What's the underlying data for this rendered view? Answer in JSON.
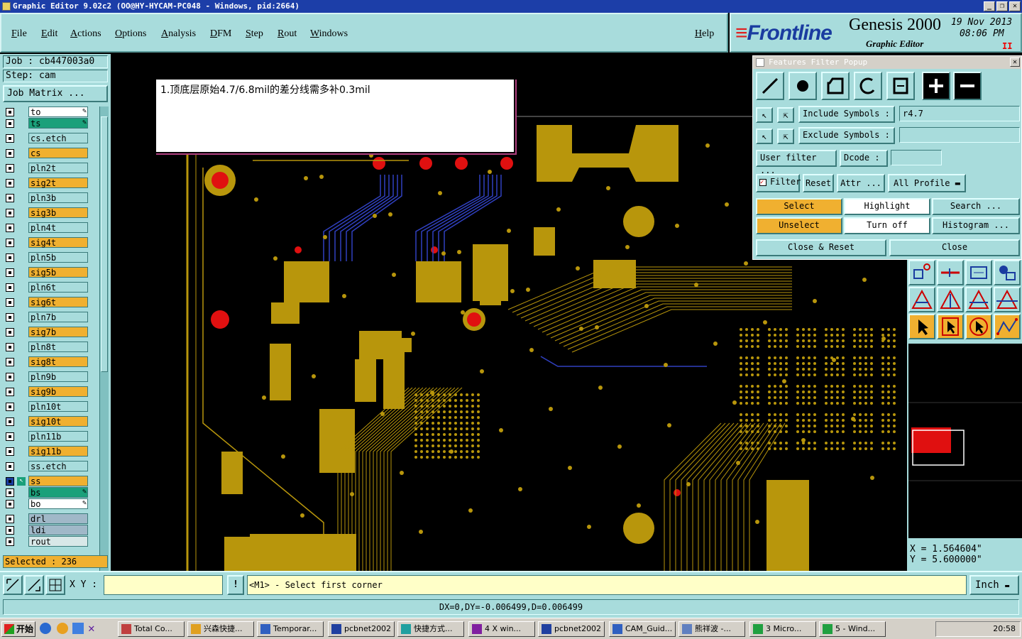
{
  "window": {
    "title": "Graphic Editor 9.02c2  (OO@HY-HYCAM-PC048 - Windows, pid:2664)"
  },
  "menu": [
    "File",
    "Edit",
    "Actions",
    "Options",
    "Analysis",
    "DFM",
    "Step",
    "Rout",
    "Windows"
  ],
  "help_label": "Help",
  "brand": {
    "logo": "Frontline",
    "product": "Genesis 2000",
    "subtitle": "Graphic Editor",
    "date": "19 Nov 2013",
    "time": "08:06 PM",
    "pause": "II"
  },
  "job": {
    "job_label": "Job : cb447003a0",
    "step_label": "Step: cam",
    "matrix_button": "Job Matrix ..."
  },
  "layers": [
    {
      "name": "to",
      "color": "#ffffff",
      "marker": "edit"
    },
    {
      "name": "ts",
      "color": "#1aa07a",
      "marker": "edit"
    },
    {
      "name": "cs.etch",
      "color": "#a8dcdc",
      "marker": ""
    },
    {
      "name": "cs",
      "color": "#f0b030",
      "marker": ""
    },
    {
      "name": "pln2t",
      "color": "#a8dcdc",
      "marker": ""
    },
    {
      "name": "sig2t",
      "color": "#f0b030",
      "marker": ""
    },
    {
      "name": "pln3b",
      "color": "#a8dcdc",
      "marker": ""
    },
    {
      "name": "sig3b",
      "color": "#f0b030",
      "marker": ""
    },
    {
      "name": "pln4t",
      "color": "#a8dcdc",
      "marker": ""
    },
    {
      "name": "sig4t",
      "color": "#f0b030",
      "marker": ""
    },
    {
      "name": "pln5b",
      "color": "#a8dcdc",
      "marker": ""
    },
    {
      "name": "sig5b",
      "color": "#f0b030",
      "marker": ""
    },
    {
      "name": "pln6t",
      "color": "#a8dcdc",
      "marker": ""
    },
    {
      "name": "sig6t",
      "color": "#f0b030",
      "marker": ""
    },
    {
      "name": "pln7b",
      "color": "#a8dcdc",
      "marker": ""
    },
    {
      "name": "sig7b",
      "color": "#f0b030",
      "marker": ""
    },
    {
      "name": "pln8t",
      "color": "#a8dcdc",
      "marker": ""
    },
    {
      "name": "sig8t",
      "color": "#f0b030",
      "marker": ""
    },
    {
      "name": "pln9b",
      "color": "#a8dcdc",
      "marker": ""
    },
    {
      "name": "sig9b",
      "color": "#f0b030",
      "marker": ""
    },
    {
      "name": "pln10t",
      "color": "#a8dcdc",
      "marker": ""
    },
    {
      "name": "sig10t",
      "color": "#f0b030",
      "marker": ""
    },
    {
      "name": "pln11b",
      "color": "#a8dcdc",
      "marker": ""
    },
    {
      "name": "sig11b",
      "color": "#f0b030",
      "marker": ""
    },
    {
      "name": "ss.etch",
      "color": "#a8dcdc",
      "marker": ""
    },
    {
      "name": "ss",
      "color": "#f0b030",
      "marker": "work"
    },
    {
      "name": "bs",
      "color": "#1aa07a",
      "marker": "edit"
    },
    {
      "name": "bo",
      "color": "#ffffff",
      "marker": "edit"
    },
    {
      "name": "drl",
      "color": "#a0b8c8",
      "marker": ""
    },
    {
      "name": "ldi",
      "color": "#a0b8c8",
      "marker": ""
    },
    {
      "name": "rout",
      "color": "#d8e8e8",
      "marker": ""
    }
  ],
  "selected_label": "Selected : 236",
  "note_text": "1.顶底层原始4.7/6.8mil的差分线需多补0.3mil",
  "filter_popup": {
    "title": "Features Filter Popup",
    "include_label": "Include Symbols :",
    "include_value": "r4.7",
    "exclude_label": "Exclude Symbols :",
    "exclude_value": "",
    "user_filter": "User filter ...",
    "dcode_label": "Dcode :",
    "dcode_value": "",
    "filter_label": "Filter",
    "reset": "Reset",
    "attr": "Attr ...",
    "profile": "All Profile",
    "select": "Select",
    "highlight": "Highlight",
    "search": "Search ...",
    "unselect": "Unselect",
    "turn_off": "Turn off",
    "histogram": "Histogram ...",
    "close_reset": "Close & Reset",
    "close": "Close"
  },
  "coords": {
    "x": "X = 1.564604\"",
    "y": "Y = 5.600000\""
  },
  "command": {
    "xy_label": "X Y :",
    "xy_value": "",
    "prompt": "<M1> - Select first corner",
    "unit": "Inch"
  },
  "status_line": "DX=0,DY=-0.006499,D=0.006499",
  "taskbar": {
    "start": "开始",
    "tasks": [
      "Total Co...",
      "兴森快捷...",
      "Temporar...",
      "pcbnet2002",
      "快捷方式...",
      "4 X win...",
      "pcbnet2002",
      "CAM_Guid...",
      "熊祥波 -...",
      "3 Micro...",
      "5 - Wind..."
    ],
    "clock": "20:58"
  },
  "colors": {
    "copper": "#b8960c",
    "trace_blue": "#3040c0",
    "pad_red": "#e01010",
    "panel": "#a8dcdc"
  }
}
